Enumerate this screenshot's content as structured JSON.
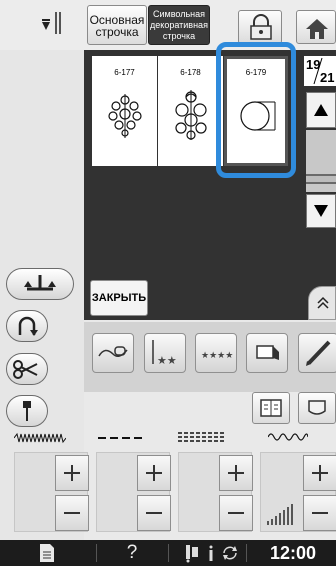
{
  "tabs": {
    "basic": "Основная\nстрочка",
    "decorative": "Символьная\nдекоративная\nстрочка"
  },
  "stitch_page": {
    "current": "19",
    "total": "21"
  },
  "stitches": [
    {
      "number": "6-177",
      "selected": false
    },
    {
      "number": "6-178",
      "selected": false
    },
    {
      "number": "6-179",
      "selected": true
    }
  ],
  "close_label": "ЗАКРЫТЬ",
  "status": {
    "time": "12:00",
    "help": "?"
  },
  "colors": {
    "selection": "#2f8bdc",
    "panel": "#323232",
    "statusbar": "#1c1c1c"
  }
}
